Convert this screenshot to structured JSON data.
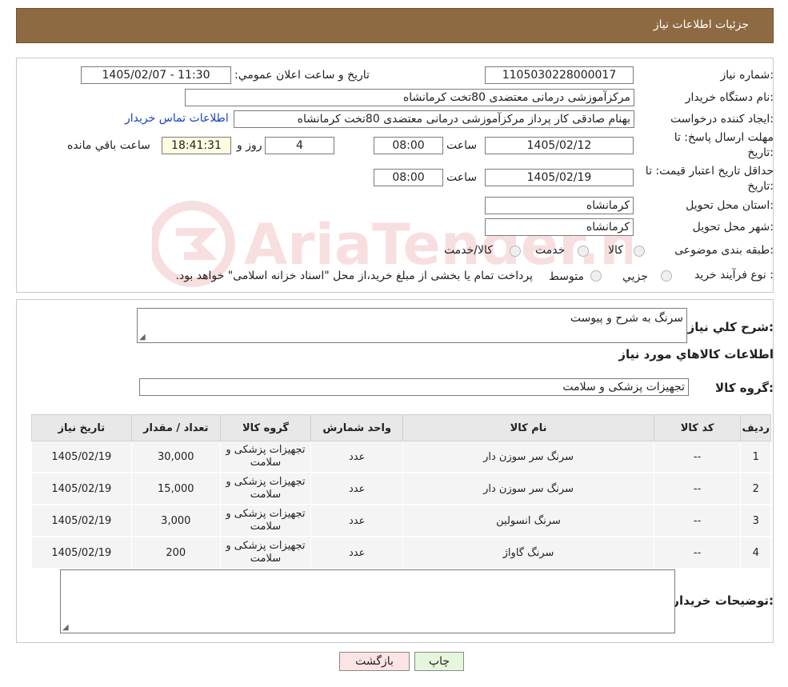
{
  "header": {
    "title": "جزئیات اطلاعات نیاز"
  },
  "form": {
    "need_number_label": "شماره نیاز:",
    "need_number": "1105030228000017",
    "announce_label": "تاريخ و ساعت اعلان عمومي:",
    "announce_value": "1405/02/07 - 11:30",
    "buyer_org_label": "نام دستگاه خريدار:",
    "buyer_org": "مرکزآموزشی درمانی معتضدی 80تخت کرمانشاه",
    "creator_label": "ايجاد کننده درخواست:",
    "creator": "بهنام صادقی کار پرداز مرکزآموزشی درمانی معتضدی 80تخت کرمانشاه",
    "contact_link": "اطلاعات تماس خريدار",
    "deadline_label_1": "مهلت ارسال پاسخ: تا",
    "deadline_label_2": "تاريخ:",
    "deadline_date": "1405/02/12",
    "time_label": "ساعت",
    "deadline_time": "08:00",
    "days_value": "4",
    "days_label": "روز و",
    "remaining_time": "18:41:31",
    "remaining_label": "ساعت باقي مانده",
    "validity_label_1": "حداقل تاريخ اعتبار قيمت: تا",
    "validity_label_2": "تاريخ:",
    "validity_date": "1405/02/19",
    "validity_time": "08:00",
    "province_label": "استان محل تحويل:",
    "province": "کرمانشاه",
    "city_label": "شهر محل تحويل:",
    "city": "کرمانشاه",
    "category_label": "طبقه بندی موضوعی:",
    "category_options": [
      "کالا",
      "خدمت",
      "کالا/خدمت"
    ],
    "process_label": "نوع فرآيند خريد :",
    "process_options": [
      "جزيي",
      "متوسط"
    ],
    "process_note": "پرداخت تمام یا بخشی از مبلغ خرید،از محل \"اسناد خزانه اسلامی\" خواهد بود."
  },
  "summary": {
    "description_label": "شرح کلي نياز:",
    "description": "سرنگ به شرح و پیوست",
    "items_title": "اطلاعات کالاهاي مورد نياز",
    "group_label": "گروه کالا:",
    "group_value": "تجهیزات پزشکی و سلامت",
    "columns": [
      "رديف",
      "کد کالا",
      "نام کالا",
      "واحد شمارش",
      "گروه کالا",
      "تعداد / مقدار",
      "تاريخ نياز"
    ],
    "rows": [
      {
        "idx": "1",
        "code": "--",
        "name": "سرنگ سر سوزن دار",
        "unit": "عدد",
        "group": "تجهیزات پزشکی و سلامت",
        "qty": "30,000",
        "date": "1405/02/19"
      },
      {
        "idx": "2",
        "code": "--",
        "name": "سرنگ سر سوزن دار",
        "unit": "عدد",
        "group": "تجهیزات پزشکی و سلامت",
        "qty": "15,000",
        "date": "1405/02/19"
      },
      {
        "idx": "3",
        "code": "--",
        "name": "سرنگ انسولین",
        "unit": "عدد",
        "group": "تجهیزات پزشکی و سلامت",
        "qty": "3,000",
        "date": "1405/02/19"
      },
      {
        "idx": "4",
        "code": "--",
        "name": "سرنگ گاواژ",
        "unit": "عدد",
        "group": "تجهیزات پزشکی و سلامت",
        "qty": "200",
        "date": "1405/02/19"
      }
    ],
    "buyer_notes_label": "توضيحات خريدار:",
    "buyer_notes": ""
  },
  "buttons": {
    "print": "چاپ",
    "back": "بازگشت"
  },
  "watermark": {
    "text": "AriaTender.neT"
  },
  "colors": {
    "header": "#8e6a42",
    "back_button": "#fde3e3",
    "print_button": "#e6f6dc",
    "link": "#1a3ec8"
  }
}
